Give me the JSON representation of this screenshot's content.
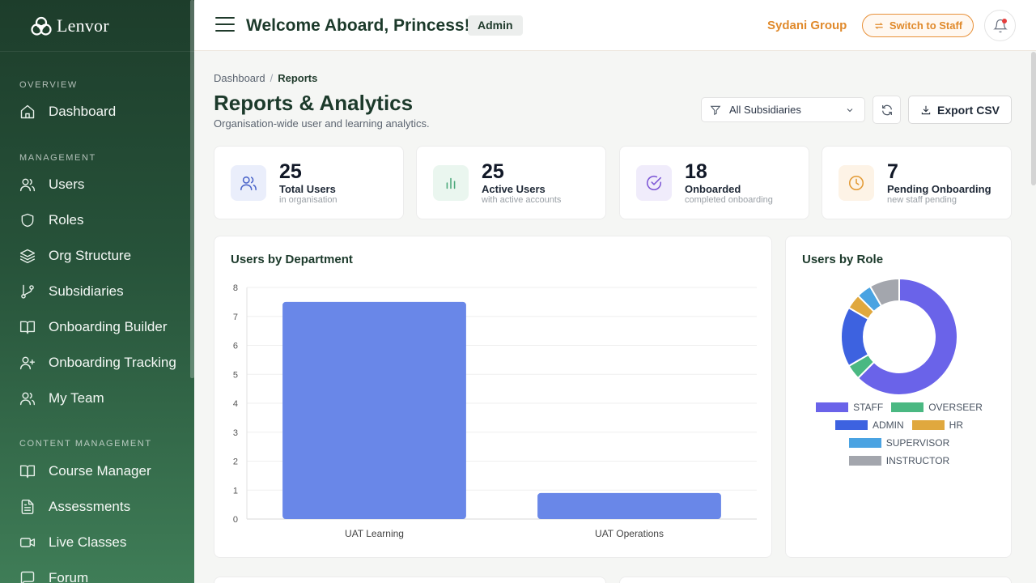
{
  "brand": {
    "name": "Lenvor"
  },
  "sidebar": {
    "sections": [
      {
        "title": "OVERVIEW",
        "items": [
          {
            "label": "Dashboard",
            "icon": "home-icon"
          }
        ]
      },
      {
        "title": "MANAGEMENT",
        "items": [
          {
            "label": "Users",
            "icon": "users-icon"
          },
          {
            "label": "Roles",
            "icon": "shield-icon"
          },
          {
            "label": "Org Structure",
            "icon": "layers-icon"
          },
          {
            "label": "Subsidiaries",
            "icon": "git-branch-icon"
          },
          {
            "label": "Onboarding Builder",
            "icon": "book-open-icon"
          },
          {
            "label": "Onboarding Tracking",
            "icon": "user-plus-icon"
          },
          {
            "label": "My Team",
            "icon": "users-icon"
          }
        ]
      },
      {
        "title": "CONTENT MANAGEMENT",
        "items": [
          {
            "label": "Course Manager",
            "icon": "book-open-icon"
          },
          {
            "label": "Assessments",
            "icon": "file-text-icon"
          },
          {
            "label": "Live Classes",
            "icon": "video-icon"
          },
          {
            "label": "Forum",
            "icon": "message-square-icon"
          }
        ]
      }
    ]
  },
  "header": {
    "welcome": "Welcome Aboard, Princess!",
    "role_badge": "Admin",
    "org_name": "Sydani Group",
    "switch_label": "Switch to Staff"
  },
  "page": {
    "breadcrumb": {
      "root": "Dashboard",
      "sep": "/",
      "current": "Reports"
    },
    "title": "Reports & Analytics",
    "subtitle": "Organisation-wide user and learning analytics.",
    "filter_value": "All Subsidiaries",
    "export_label": "Export CSV"
  },
  "stats": [
    {
      "value": "25",
      "label": "Total Users",
      "sub": "in organisation",
      "icon": "users-icon",
      "color": "#4a64c9",
      "bg": "#eaeefb"
    },
    {
      "value": "25",
      "label": "Active Users",
      "sub": "with active accounts",
      "icon": "bar-chart-icon",
      "color": "#4aa87a",
      "bg": "#eaf6ef"
    },
    {
      "value": "18",
      "label": "Onboarded",
      "sub": "completed onboarding",
      "icon": "check-circle-icon",
      "color": "#7e58d6",
      "bg": "#f0ecfb"
    },
    {
      "value": "7",
      "label": "Pending Onboarding",
      "sub": "new staff pending",
      "icon": "clock-icon",
      "color": "#e39a35",
      "bg": "#fdf3e6"
    }
  ],
  "chart_data": [
    {
      "type": "bar",
      "title": "Users by Department",
      "categories": [
        "UAT Learning",
        "UAT Operations"
      ],
      "values": [
        7.5,
        0.9
      ],
      "ylim": [
        0,
        8
      ],
      "yticks": [
        "0",
        "1",
        "2",
        "3",
        "4",
        "5",
        "6",
        "7",
        "8"
      ],
      "grid": true,
      "color": "#6987e8"
    },
    {
      "type": "pie",
      "title": "Users by Role",
      "labels": [
        "STAFF",
        "OVERSEER",
        "ADMIN",
        "HR",
        "SUPERVISOR",
        "INSTRUCTOR"
      ],
      "values": [
        15,
        1,
        4,
        1,
        1,
        2
      ],
      "colors": [
        "#6a63e9",
        "#4ab882",
        "#3d62e0",
        "#e0a83e",
        "#4aa3e2",
        "#a3a6ad"
      ],
      "legend": "bottom"
    }
  ]
}
